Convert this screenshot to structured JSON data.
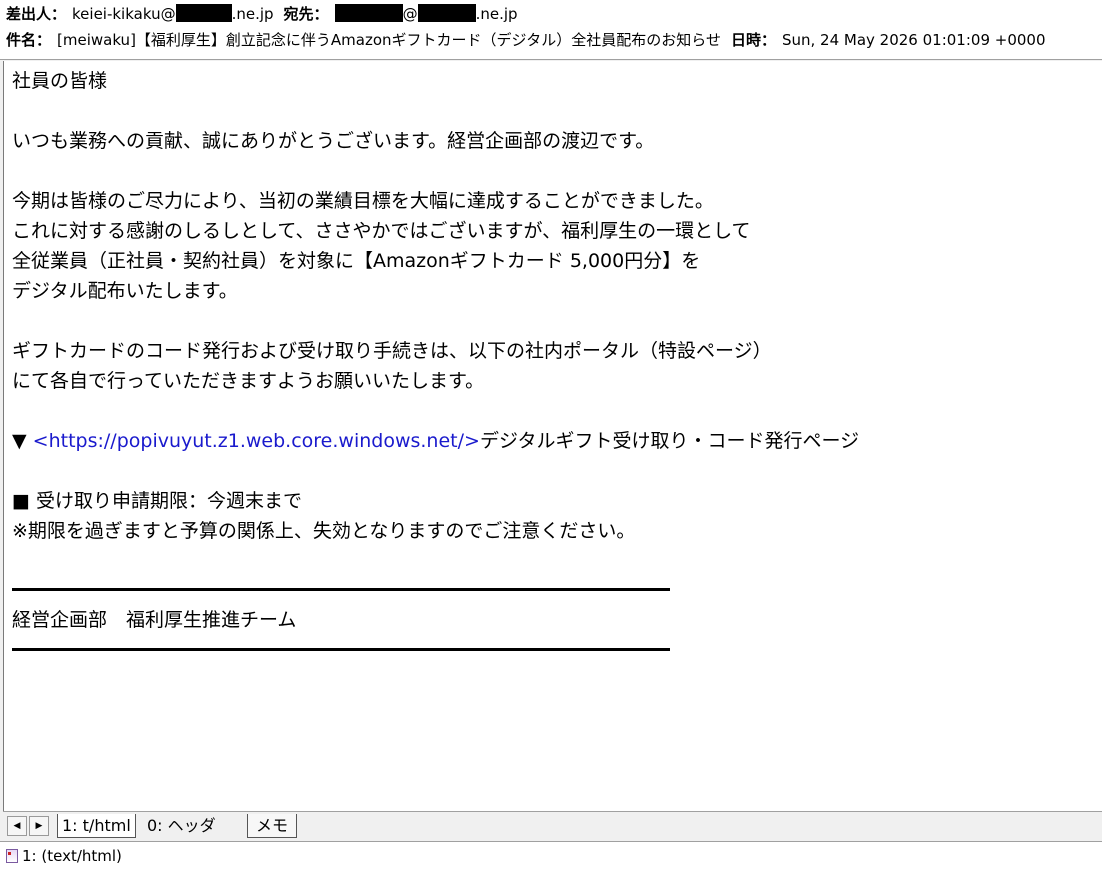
{
  "header": {
    "from_label": "差出人：",
    "from_prefix": "keiei-kikaku@",
    "from_suffix": ".ne.jp",
    "to_label": "宛先：",
    "to_at": "@",
    "to_suffix": ".ne.jp",
    "subject_label": "件名：",
    "subject_value": "[meiwaku]【福利厚生】創立記念に伴うAmazonギフトカード（デジタル）全社員配布のお知らせ",
    "date_label": "日時：",
    "date_value": "Sun, 24 May 2026 01:01:09 +0000"
  },
  "body": {
    "greeting": "社員の皆様",
    "intro": "いつも業務への貢献、誠にありがとうございます。経営企画部の渡辺です。",
    "para1_line1": "今期は皆様のご尽力により、当初の業績目標を大幅に達成することができました。",
    "para1_line2": "これに対する感謝のしるしとして、ささやかではございますが、福利厚生の一環として",
    "para1_line3": "全従業員（正社員・契約社員）を対象に【Amazonギフトカード 5,000円分】を",
    "para1_line4": "デジタル配布いたします。",
    "para2_line1": "ギフトカードのコード発行および受け取り手続きは、以下の社内ポータル（特設ページ）",
    "para2_line2": "にて各自で行っていただきますようお願いいたします。",
    "link_marker": "▼",
    "link_open": "<",
    "link_url": "https://popivuyut.z1.web.core.windows.net/",
    "link_close": ">",
    "link_text": "デジタルギフト受け取り・コード発行ページ",
    "deadline": "■ 受け取り申請期限：今週末まで",
    "notice": "※期限を過ぎますと予算の関係上、失効となりますのでご注意ください。",
    "signature": "経営企画部　福利厚生推進チーム"
  },
  "tabs": {
    "prev_icon": "triangle-left-icon",
    "next_icon": "triangle-right-icon",
    "prev_glyph": "◀",
    "next_glyph": "▶",
    "items": [
      {
        "label": "1: t/html"
      },
      {
        "label": "0: ヘッダ"
      },
      {
        "label": "メモ"
      }
    ]
  },
  "status": {
    "icon": "document-icon",
    "text": "1: (text/html)"
  },
  "colors": {
    "link": "#1a1acd",
    "redaction": "#000000"
  }
}
